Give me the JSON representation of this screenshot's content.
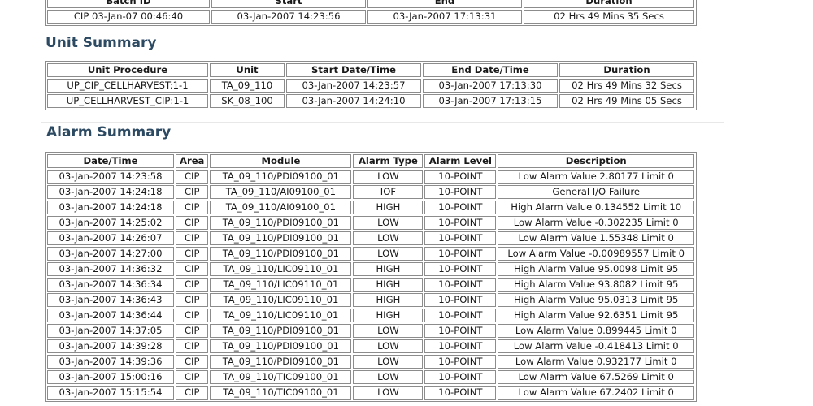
{
  "batch_summary": {
    "columns": [
      "Batch ID",
      "Start",
      "End",
      "Duration"
    ],
    "rows": [
      [
        "CIP 03-Jan-07 00:46:40",
        "03-Jan-2007 14:23:56",
        "03-Jan-2007 17:13:31",
        "02 Hrs 49 Mins 35 Secs"
      ]
    ]
  },
  "unit_summary": {
    "title": "Unit Summary",
    "columns": [
      "Unit Procedure",
      "Unit",
      "Start Date/Time",
      "End Date/Time",
      "Duration"
    ],
    "rows": [
      [
        "UP_CIP_CELLHARVEST:1-1",
        "TA_09_110",
        "03-Jan-2007 14:23:57",
        "03-Jan-2007 17:13:30",
        "02 Hrs 49 Mins 32 Secs"
      ],
      [
        "UP_CELLHARVEST_CIP:1-1",
        "SK_08_100",
        "03-Jan-2007 14:24:10",
        "03-Jan-2007 17:13:15",
        "02 Hrs 49 Mins 05 Secs"
      ]
    ]
  },
  "alarm_summary": {
    "title": "Alarm Summary",
    "columns": [
      "Date/Time",
      "Area",
      "Module",
      "Alarm Type",
      "Alarm Level",
      "Description"
    ],
    "rows": [
      [
        "03-Jan-2007 14:23:58",
        "CIP",
        "TA_09_110/PDI09100_01",
        "LOW",
        "10-POINT",
        "Low Alarm Value 2.80177 Limit 0"
      ],
      [
        "03-Jan-2007 14:24:18",
        "CIP",
        "TA_09_110/AI09100_01",
        "IOF",
        "10-POINT",
        "General I/O Failure"
      ],
      [
        "03-Jan-2007 14:24:18",
        "CIP",
        "TA_09_110/AI09100_01",
        "HIGH",
        "10-POINT",
        "High Alarm Value 0.134552 Limit 10"
      ],
      [
        "03-Jan-2007 14:25:02",
        "CIP",
        "TA_09_110/PDI09100_01",
        "LOW",
        "10-POINT",
        "Low Alarm Value -0.302235 Limit 0"
      ],
      [
        "03-Jan-2007 14:26:07",
        "CIP",
        "TA_09_110/PDI09100_01",
        "LOW",
        "10-POINT",
        "Low Alarm Value 1.55348 Limit 0"
      ],
      [
        "03-Jan-2007 14:27:00",
        "CIP",
        "TA_09_110/PDI09100_01",
        "LOW",
        "10-POINT",
        "Low Alarm Value -0.00989557 Limit 0"
      ],
      [
        "03-Jan-2007 14:36:32",
        "CIP",
        "TA_09_110/LIC09110_01",
        "HIGH",
        "10-POINT",
        "High Alarm Value 95.0098 Limit 95"
      ],
      [
        "03-Jan-2007 14:36:34",
        "CIP",
        "TA_09_110/LIC09110_01",
        "HIGH",
        "10-POINT",
        "High Alarm Value 93.8082 Limit 95"
      ],
      [
        "03-Jan-2007 14:36:43",
        "CIP",
        "TA_09_110/LIC09110_01",
        "HIGH",
        "10-POINT",
        "High Alarm Value 95.0313 Limit 95"
      ],
      [
        "03-Jan-2007 14:36:44",
        "CIP",
        "TA_09_110/LIC09110_01",
        "HIGH",
        "10-POINT",
        "High Alarm Value 92.6351 Limit 95"
      ],
      [
        "03-Jan-2007 14:37:05",
        "CIP",
        "TA_09_110/PDI09100_01",
        "LOW",
        "10-POINT",
        "Low Alarm Value 0.899445 Limit 0"
      ],
      [
        "03-Jan-2007 14:39:28",
        "CIP",
        "TA_09_110/PDI09100_01",
        "LOW",
        "10-POINT",
        "Low Alarm Value -0.418413 Limit 0"
      ],
      [
        "03-Jan-2007 14:39:36",
        "CIP",
        "TA_09_110/PDI09100_01",
        "LOW",
        "10-POINT",
        "Low Alarm Value 0.932177 Limit 0"
      ],
      [
        "03-Jan-2007 15:00:16",
        "CIP",
        "TA_09_110/TIC09100_01",
        "LOW",
        "10-POINT",
        "Low Alarm Value 67.5269 Limit 0"
      ],
      [
        "03-Jan-2007 15:15:54",
        "CIP",
        "TA_09_110/TIC09100_01",
        "LOW",
        "10-POINT",
        "Low Alarm Value 67.2402 Limit 0"
      ]
    ]
  }
}
